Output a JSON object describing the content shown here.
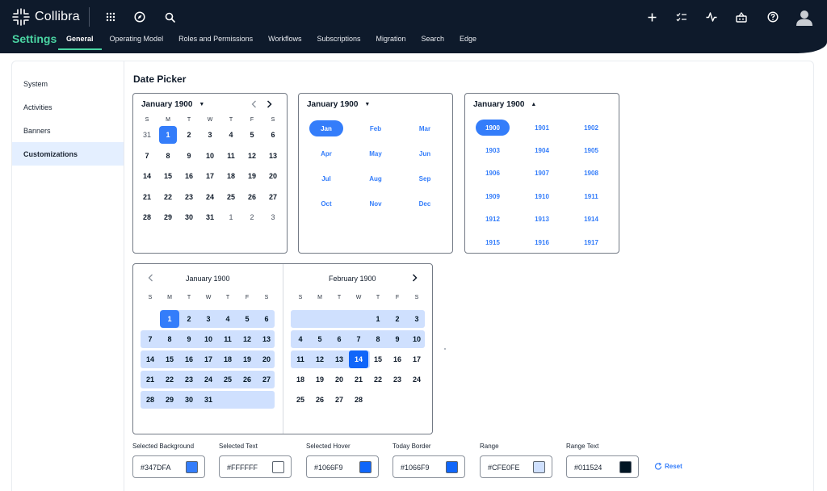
{
  "app": {
    "brand": "Collibra"
  },
  "header": {
    "settings_title": "Settings",
    "nav": [
      "General",
      "Operating Model",
      "Roles and Permissions",
      "Workflows",
      "Subscriptions",
      "Migration",
      "Search",
      "Edge"
    ],
    "active_nav": "General",
    "icons_left": [
      "apps-grid-icon",
      "compass-icon",
      "search-icon"
    ],
    "icons_right": [
      "plus-icon",
      "checklist-icon",
      "activity-icon",
      "basket-icon",
      "help-icon",
      "user-avatar-icon"
    ]
  },
  "sidebar": {
    "items": [
      "System",
      "Activities",
      "Banners",
      "Customizations"
    ],
    "active": "Customizations"
  },
  "page": {
    "title": "Date Picker"
  },
  "day_picker": {
    "header": "January 1900",
    "dow": [
      "S",
      "M",
      "T",
      "W",
      "T",
      "F",
      "S"
    ],
    "weeks": [
      [
        "31",
        "1",
        "2",
        "3",
        "4",
        "5",
        "6"
      ],
      [
        "7",
        "8",
        "9",
        "10",
        "11",
        "12",
        "13"
      ],
      [
        "14",
        "15",
        "16",
        "17",
        "18",
        "19",
        "20"
      ],
      [
        "21",
        "22",
        "23",
        "24",
        "25",
        "26",
        "27"
      ],
      [
        "28",
        "29",
        "30",
        "31",
        "1",
        "2",
        "3"
      ]
    ],
    "selected": "1"
  },
  "month_picker": {
    "header": "January 1900",
    "months": [
      "Jan",
      "Feb",
      "Mar",
      "Apr",
      "May",
      "Jun",
      "Jul",
      "Aug",
      "Sep",
      "Oct",
      "Nov",
      "Dec"
    ],
    "selected": "Jan"
  },
  "year_picker": {
    "header": "January 1900",
    "years": [
      "1900",
      "1901",
      "1902",
      "1903",
      "1904",
      "1905",
      "1906",
      "1907",
      "1908",
      "1909",
      "1910",
      "1911",
      "1912",
      "1913",
      "1914",
      "1915",
      "1916",
      "1917"
    ],
    "selected": "1900"
  },
  "range_picker": {
    "left": {
      "title": "January 1900",
      "dow": [
        "S",
        "M",
        "T",
        "W",
        "T",
        "F",
        "S"
      ],
      "weeks": [
        [
          "",
          "1",
          "2",
          "3",
          "4",
          "5",
          "6"
        ],
        [
          "7",
          "8",
          "9",
          "10",
          "11",
          "12",
          "13"
        ],
        [
          "14",
          "15",
          "16",
          "17",
          "18",
          "19",
          "20"
        ],
        [
          "21",
          "22",
          "23",
          "24",
          "25",
          "26",
          "27"
        ],
        [
          "28",
          "29",
          "30",
          "31",
          "",
          "",
          ""
        ]
      ]
    },
    "right": {
      "title": "February 1900",
      "dow": [
        "S",
        "M",
        "T",
        "W",
        "T",
        "F",
        "S"
      ],
      "weeks": [
        [
          "",
          "",
          "",
          "",
          "1",
          "2",
          "3"
        ],
        [
          "4",
          "5",
          "6",
          "7",
          "8",
          "9",
          "10"
        ],
        [
          "11",
          "12",
          "13",
          "14",
          "15",
          "16",
          "17"
        ],
        [
          "18",
          "19",
          "20",
          "21",
          "22",
          "23",
          "24"
        ],
        [
          "25",
          "26",
          "27",
          "28",
          "",
          "",
          ""
        ]
      ]
    }
  },
  "colors": [
    {
      "label": "Selected Background",
      "value": "#347DFA",
      "swatch": "#347dfa"
    },
    {
      "label": "Selected Text",
      "value": "#FFFFFF",
      "swatch": "#ffffff"
    },
    {
      "label": "Selected Hover",
      "value": "#1066F9",
      "swatch": "#1066f9"
    },
    {
      "label": "Today Border",
      "value": "#1066F9",
      "swatch": "#1066f9"
    },
    {
      "label": "Range",
      "value": "#CFE0FE",
      "swatch": "#cfe0fe"
    },
    {
      "label": "Range Text",
      "value": "#011524",
      "swatch": "#011524"
    }
  ],
  "reset_label": "Reset"
}
